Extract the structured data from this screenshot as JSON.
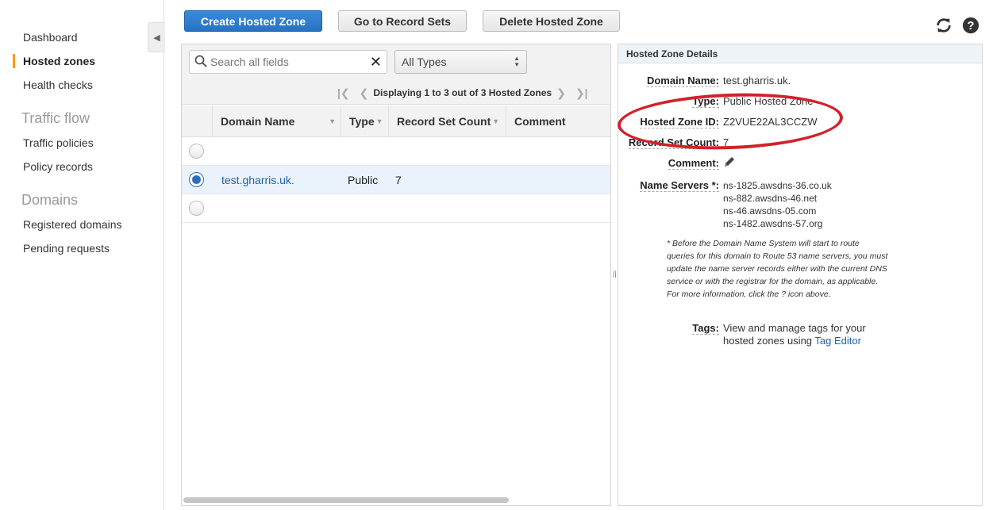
{
  "sidebar": {
    "items": [
      {
        "label": "Dashboard"
      },
      {
        "label": "Hosted zones"
      },
      {
        "label": "Health checks"
      }
    ],
    "groups": [
      {
        "title": "Traffic flow",
        "items": [
          {
            "label": "Traffic policies"
          },
          {
            "label": "Policy records"
          }
        ]
      },
      {
        "title": "Domains",
        "items": [
          {
            "label": "Registered domains"
          },
          {
            "label": "Pending requests"
          }
        ]
      }
    ]
  },
  "toolbar": {
    "create_label": "Create Hosted Zone",
    "goto_label": "Go to Record Sets",
    "delete_label": "Delete Hosted Zone",
    "refresh_icon": "refresh-icon",
    "help_icon": "help-icon"
  },
  "search": {
    "placeholder": "Search all fields"
  },
  "filter": {
    "selected": "All Types"
  },
  "pager": {
    "text": "Displaying 1 to 3 out of 3 Hosted Zones"
  },
  "table": {
    "columns": [
      "Domain Name",
      "Type",
      "Record Set Count",
      "Comment"
    ],
    "rows": [
      {
        "domain": "",
        "type": "",
        "count": "",
        "comment": ""
      },
      {
        "domain": "test.gharris.uk.",
        "type": "Public",
        "count": "7",
        "comment": ""
      },
      {
        "domain": "",
        "type": "",
        "count": "",
        "comment": ""
      }
    ]
  },
  "details": {
    "header": "Hosted Zone Details",
    "domain_label": "Domain Name:",
    "domain_value": "test.gharris.uk.",
    "type_label": "Type:",
    "type_value": "Public Hosted Zone",
    "zone_id_label": "Hosted Zone ID:",
    "zone_id_value": "Z2VUE22AL3CCZW",
    "count_label": "Record Set Count:",
    "count_value": "7",
    "comment_label": "Comment:",
    "ns_label": "Name Servers *:",
    "name_servers": [
      "ns-1825.awsdns-36.co.uk",
      "ns-882.awsdns-46.net",
      "ns-46.awsdns-05.com",
      "ns-1482.awsdns-57.org"
    ],
    "note": "* Before the Domain Name System will start to route queries for this domain to Route 53 name servers, you must update the name server records either with the current DNS service or with the registrar for the domain, as applicable. For more information, click the ? icon above.",
    "tags_label": "Tags:",
    "tags_text": "View and manage tags for your hosted zones using",
    "tag_editor_link": "Tag Editor"
  },
  "colors": {
    "primary": "#2673c3",
    "accent": "#ff9900",
    "annotation": "#d0222b",
    "link": "#1a63b0"
  }
}
